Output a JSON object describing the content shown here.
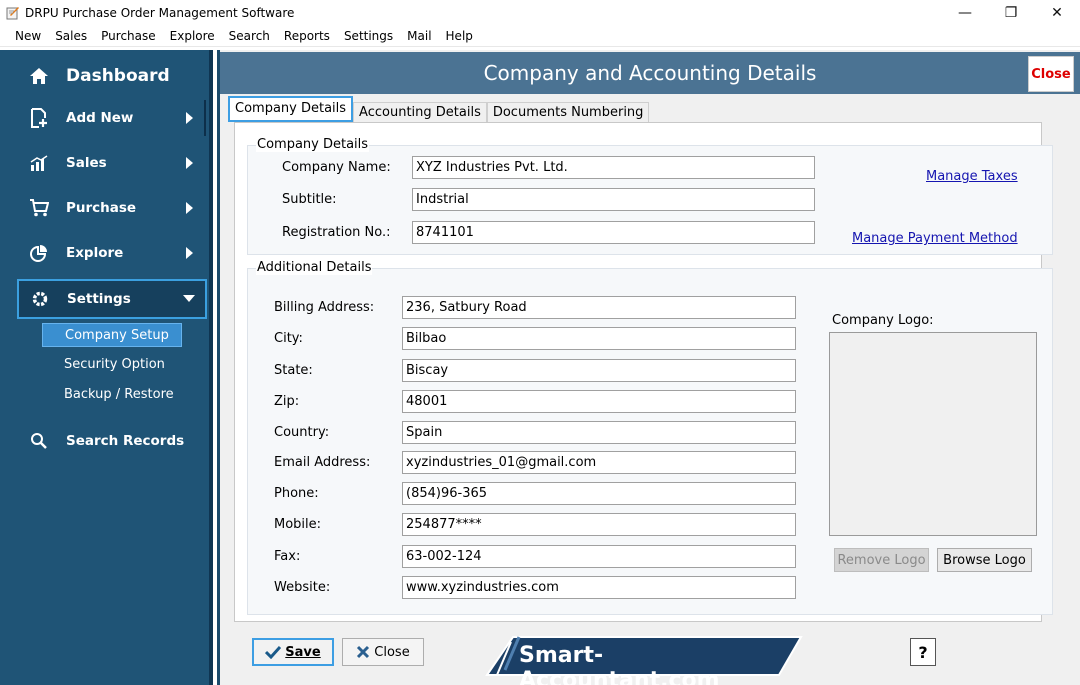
{
  "window": {
    "title": "DRPU Purchase Order Management Software",
    "minimize": "—",
    "maximize": "❐",
    "close": "✕"
  },
  "menu": [
    "New",
    "Sales",
    "Purchase",
    "Explore",
    "Search",
    "Reports",
    "Settings",
    "Mail",
    "Help"
  ],
  "sidebar": {
    "dashboard": "Dashboard",
    "add_new": "Add New",
    "sales": "Sales",
    "purchase": "Purchase",
    "explore": "Explore",
    "settings": "Settings",
    "sub_company_setup": "Company Setup",
    "sub_security_option": "Security Option",
    "sub_backup_restore": "Backup / Restore",
    "search_records": "Search Records"
  },
  "header": {
    "title": "Company and Accounting Details",
    "close": "Close"
  },
  "tabs": [
    "Company Details",
    "Accounting Details",
    "Documents Numbering"
  ],
  "company_details": {
    "group_label": "Company Details",
    "company_name_label": "Company Name:",
    "company_name": "XYZ Industries Pvt. Ltd.",
    "subtitle_label": "Subtitle:",
    "subtitle": "Indstrial",
    "registration_label": "Registration No.:",
    "registration": "8741101",
    "manage_taxes": "Manage Taxes",
    "manage_payment": "Manage Payment Method"
  },
  "additional": {
    "group_label": "Additional Details",
    "fields": [
      {
        "label": "Billing Address:",
        "value": "236, Satbury Road"
      },
      {
        "label": "City:",
        "value": "Bilbao"
      },
      {
        "label": "State:",
        "value": "Biscay"
      },
      {
        "label": "Zip:",
        "value": "48001"
      },
      {
        "label": "Country:",
        "value": "Spain"
      },
      {
        "label": "Email Address:",
        "value": "xyzindustries_01@gmail.com"
      },
      {
        "label": "Phone:",
        "value": "(854)96-365"
      },
      {
        "label": "Mobile:",
        "value": "254877****"
      },
      {
        "label": "Fax:",
        "value": "63-002-124"
      },
      {
        "label": "Website:",
        "value": "www.xyzindustries.com"
      }
    ],
    "logo_label": "Company Logo:",
    "remove_logo": "Remove Logo",
    "browse_logo": "Browse Logo"
  },
  "footer": {
    "save": "Save",
    "close": "Close",
    "brand": "Smart-Accountant.com",
    "help": "?"
  }
}
